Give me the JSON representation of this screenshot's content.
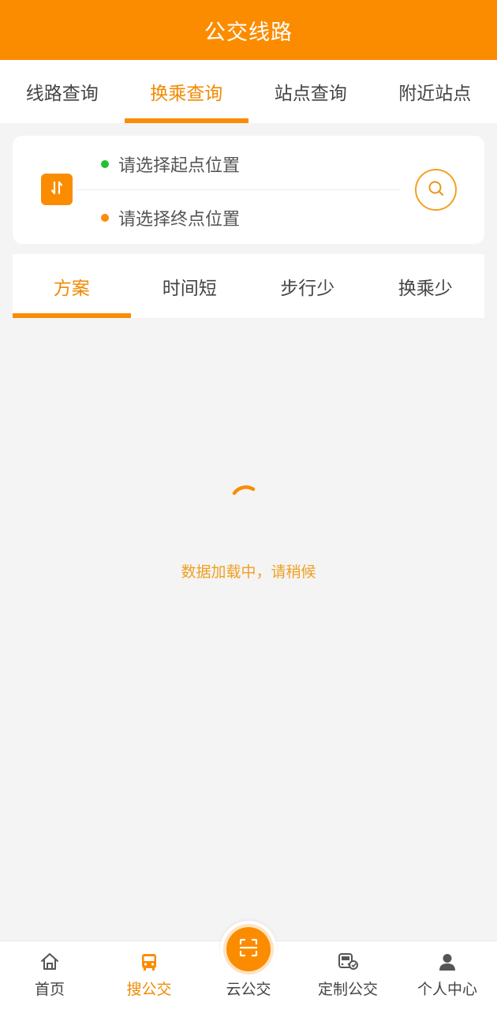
{
  "header": {
    "title": "公交线路"
  },
  "top_tabs": [
    {
      "label": "线路查询",
      "active": false
    },
    {
      "label": "换乘查询",
      "active": true
    },
    {
      "label": "站点查询",
      "active": false
    },
    {
      "label": "附近站点",
      "active": false
    }
  ],
  "search": {
    "start_placeholder": "请选择起点位置",
    "end_placeholder": "请选择终点位置",
    "swap_icon": "swap-vertical-icon",
    "search_icon": "search-icon"
  },
  "plan_tabs": [
    {
      "label": "方案",
      "active": true
    },
    {
      "label": "时间短",
      "active": false
    },
    {
      "label": "步行少",
      "active": false
    },
    {
      "label": "换乘少",
      "active": false
    }
  ],
  "loading": {
    "text": "数据加载中，请稍候"
  },
  "bottom_nav": [
    {
      "label": "首页",
      "icon": "home-icon",
      "active": false
    },
    {
      "label": "搜公交",
      "icon": "bus-icon",
      "active": true
    },
    {
      "label": "云公交",
      "icon": "scan-icon",
      "active": false
    },
    {
      "label": "定制公交",
      "icon": "custom-bus-icon",
      "active": false
    },
    {
      "label": "个人中心",
      "icon": "user-icon",
      "active": false
    }
  ],
  "colors": {
    "primary": "#fb8c00",
    "start_dot": "#1fc232",
    "end_dot": "#fb8c00",
    "loading_text": "#f0a020"
  }
}
